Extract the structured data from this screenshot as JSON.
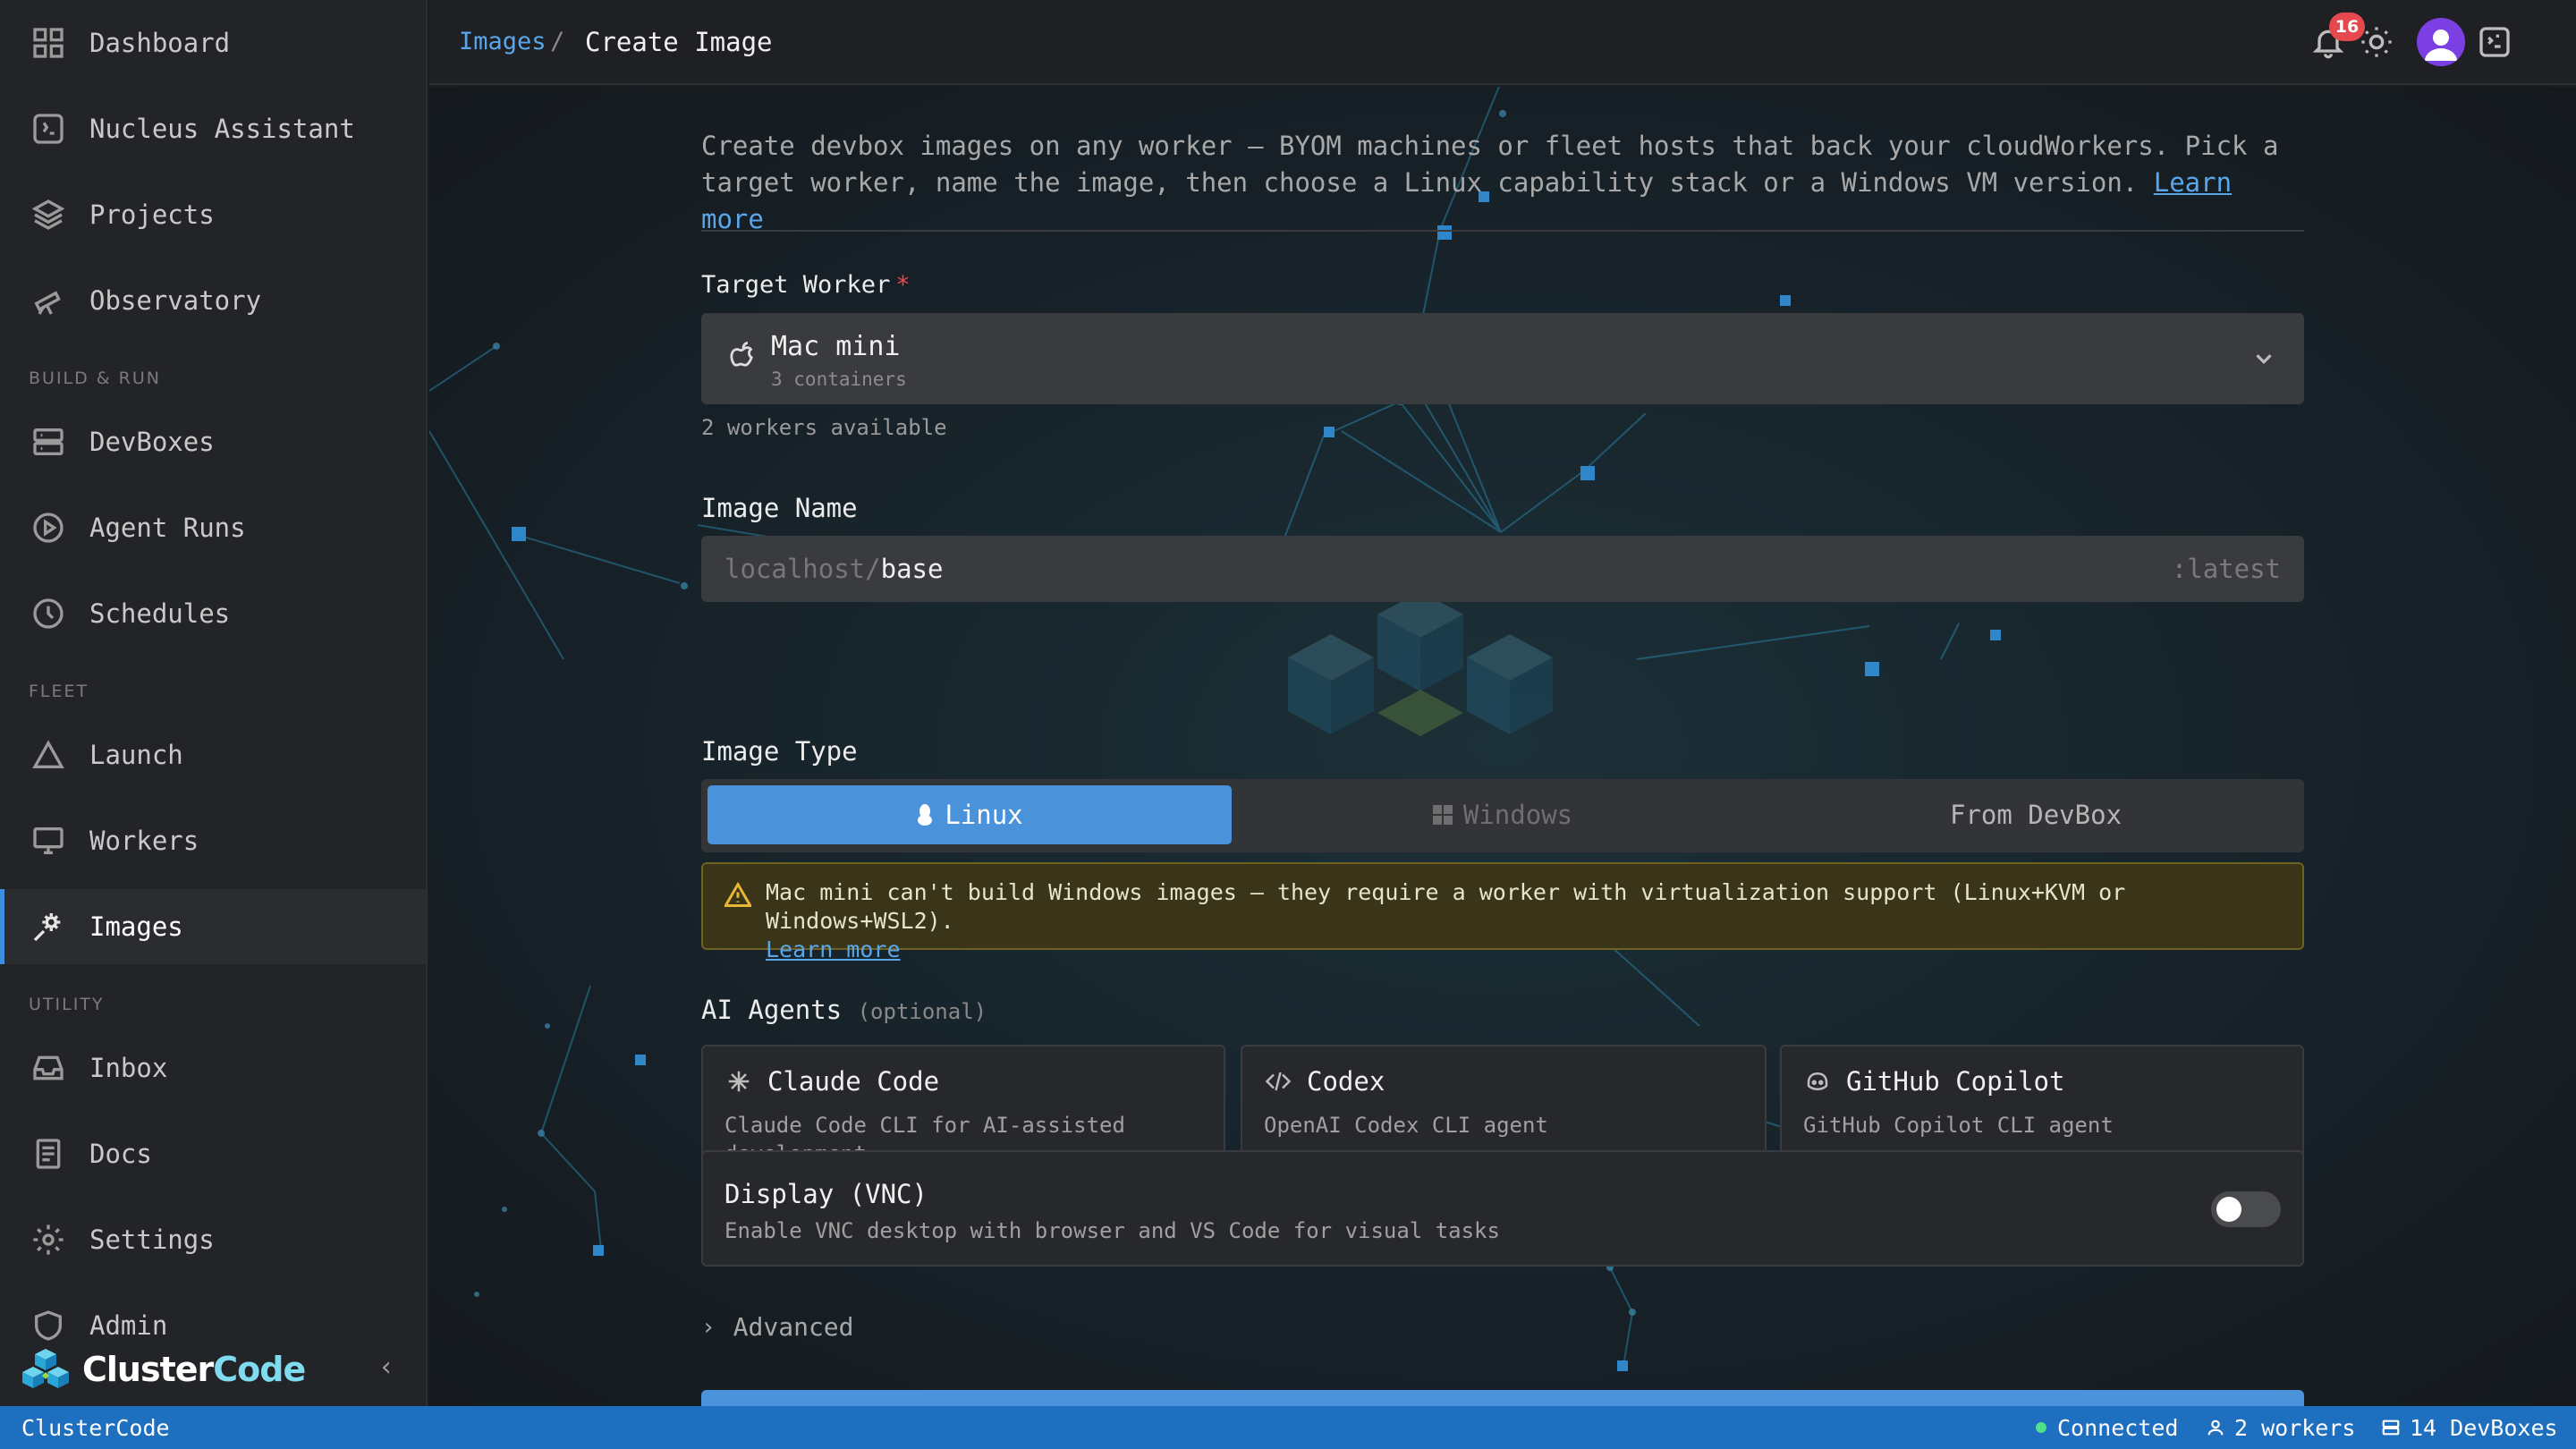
{
  "sidebar": {
    "items": [
      {
        "label": "Dashboard",
        "icon": "dashboard-icon"
      },
      {
        "label": "Nucleus Assistant",
        "icon": "assistant-icon"
      },
      {
        "label": "Projects",
        "icon": "layers-icon"
      },
      {
        "label": "Observatory",
        "icon": "telescope-icon"
      }
    ],
    "sections": [
      {
        "title": "BUILD & RUN",
        "items": [
          {
            "label": "DevBoxes",
            "icon": "server-icon"
          },
          {
            "label": "Agent Runs",
            "icon": "play-circle-icon"
          },
          {
            "label": "Schedules",
            "icon": "clock-icon"
          }
        ]
      },
      {
        "title": "FLEET",
        "items": [
          {
            "label": "Launch",
            "icon": "triangle-icon"
          },
          {
            "label": "Workers",
            "icon": "monitor-icon"
          },
          {
            "label": "Images",
            "icon": "gear-sparkle-icon",
            "active": true
          }
        ]
      },
      {
        "title": "UTILITY",
        "items": [
          {
            "label": "Inbox",
            "icon": "inbox-icon"
          },
          {
            "label": "Docs",
            "icon": "document-icon"
          },
          {
            "label": "Settings",
            "icon": "settings-icon"
          },
          {
            "label": "Admin",
            "icon": "shield-icon"
          }
        ]
      }
    ],
    "brand": {
      "part1": "Cluster",
      "part2": "Code"
    }
  },
  "header": {
    "breadcrumb_link": "Images",
    "breadcrumb_sep": "/",
    "breadcrumb_current": "Create Image",
    "notification_count": "16"
  },
  "form": {
    "intro": "Create devbox images on any worker — BYOM machines or fleet hosts that back your cloudWorkers. Pick a target worker, name the image, then choose a Linux capability stack or a Windows VM version.",
    "intro_link": "Learn more",
    "target_worker": {
      "label": "Target Worker",
      "required_mark": "*",
      "selected_title": "Mac mini",
      "selected_sub": "3 containers",
      "helper": "2 workers available"
    },
    "image_name": {
      "label": "Image Name",
      "prefix": "localhost/",
      "value": "base",
      "suffix": ":latest"
    },
    "image_type": {
      "label": "Image Type",
      "options": [
        "Linux",
        "Windows",
        "From DevBox"
      ],
      "selected": "Linux"
    },
    "warning": {
      "text": "Mac mini can't build Windows images — they require a worker with virtualization support (Linux+KVM or Windows+WSL2).",
      "link": "Learn more"
    },
    "agents": {
      "label": "AI Agents",
      "optional": "(optional)",
      "cards": [
        {
          "title": "Claude Code",
          "desc": "Claude Code CLI for AI-assisted development",
          "icon": "asterisk-icon"
        },
        {
          "title": "Codex",
          "desc": "OpenAI Codex CLI agent",
          "icon": "code-icon"
        },
        {
          "title": "GitHub Copilot",
          "desc": "GitHub Copilot CLI agent",
          "icon": "copilot-icon"
        }
      ]
    },
    "vnc": {
      "title": "Display (VNC)",
      "desc": "Enable VNC desktop with browser and VS Code for visual tasks",
      "enabled": false
    },
    "advanced_label": "Advanced"
  },
  "statusbar": {
    "app": "ClusterCode",
    "connection": "Connected",
    "workers": "2 workers",
    "devboxes": "14 DevBoxes"
  },
  "colors": {
    "accent": "#4a93da",
    "status_bar": "#1e6fbf",
    "warning_border": "#6e6222",
    "badge": "#e5484d",
    "connected": "#4ee08a"
  }
}
